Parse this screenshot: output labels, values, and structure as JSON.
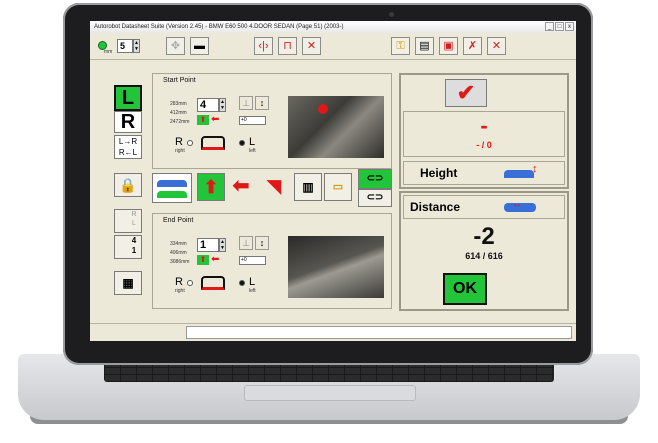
{
  "window": {
    "title": "Autorobot Datasheet Suite (Version 2.45) - BMW E60 500 4.DOOR SEDAN (Page 51) (2003-)",
    "controls": [
      "_",
      "□",
      "x"
    ]
  },
  "toolbar": {
    "unit_label": "mm",
    "step_value": "5",
    "icons": [
      "target-icon",
      "camera-icon",
      "align-center-icon",
      "frame-icon",
      "close-icon",
      "key-icon",
      "printer-icon",
      "save-icon",
      "tools-icon",
      "exit-icon"
    ]
  },
  "side": {
    "left_label": "L",
    "right_label": "R",
    "l_to_r": "L→R",
    "r_to_l": "R←L",
    "swap_r": "R",
    "swap_l": "L",
    "swap_4": "4",
    "swap_1": "1"
  },
  "start_point": {
    "title": "Start Point",
    "measure_x": "283mm",
    "measure_y": "412mm",
    "measure_z": "2472mm",
    "point_value": "4",
    "offset_value": "+0",
    "r_label": "R",
    "r_sub": "right",
    "l_label": "L",
    "l_sub": "left"
  },
  "end_point": {
    "title": "End Point",
    "measure_x": "334mm",
    "measure_y": "406mm",
    "measure_z": "3086mm",
    "point_value": "1",
    "offset_value": "+0",
    "r_label": "R",
    "r_sub": "right",
    "l_label": "L",
    "l_sub": "left"
  },
  "height_panel": {
    "value": "-",
    "sub_value": "- / 0",
    "label": "Height"
  },
  "distance_panel": {
    "label": "Distance",
    "value": "-2",
    "sub_value": "614 / 616",
    "ok_label": "OK"
  },
  "colors": {
    "accent_green": "#22c43a",
    "alert_red": "#e01818",
    "window_bg": "#ece9d8"
  }
}
